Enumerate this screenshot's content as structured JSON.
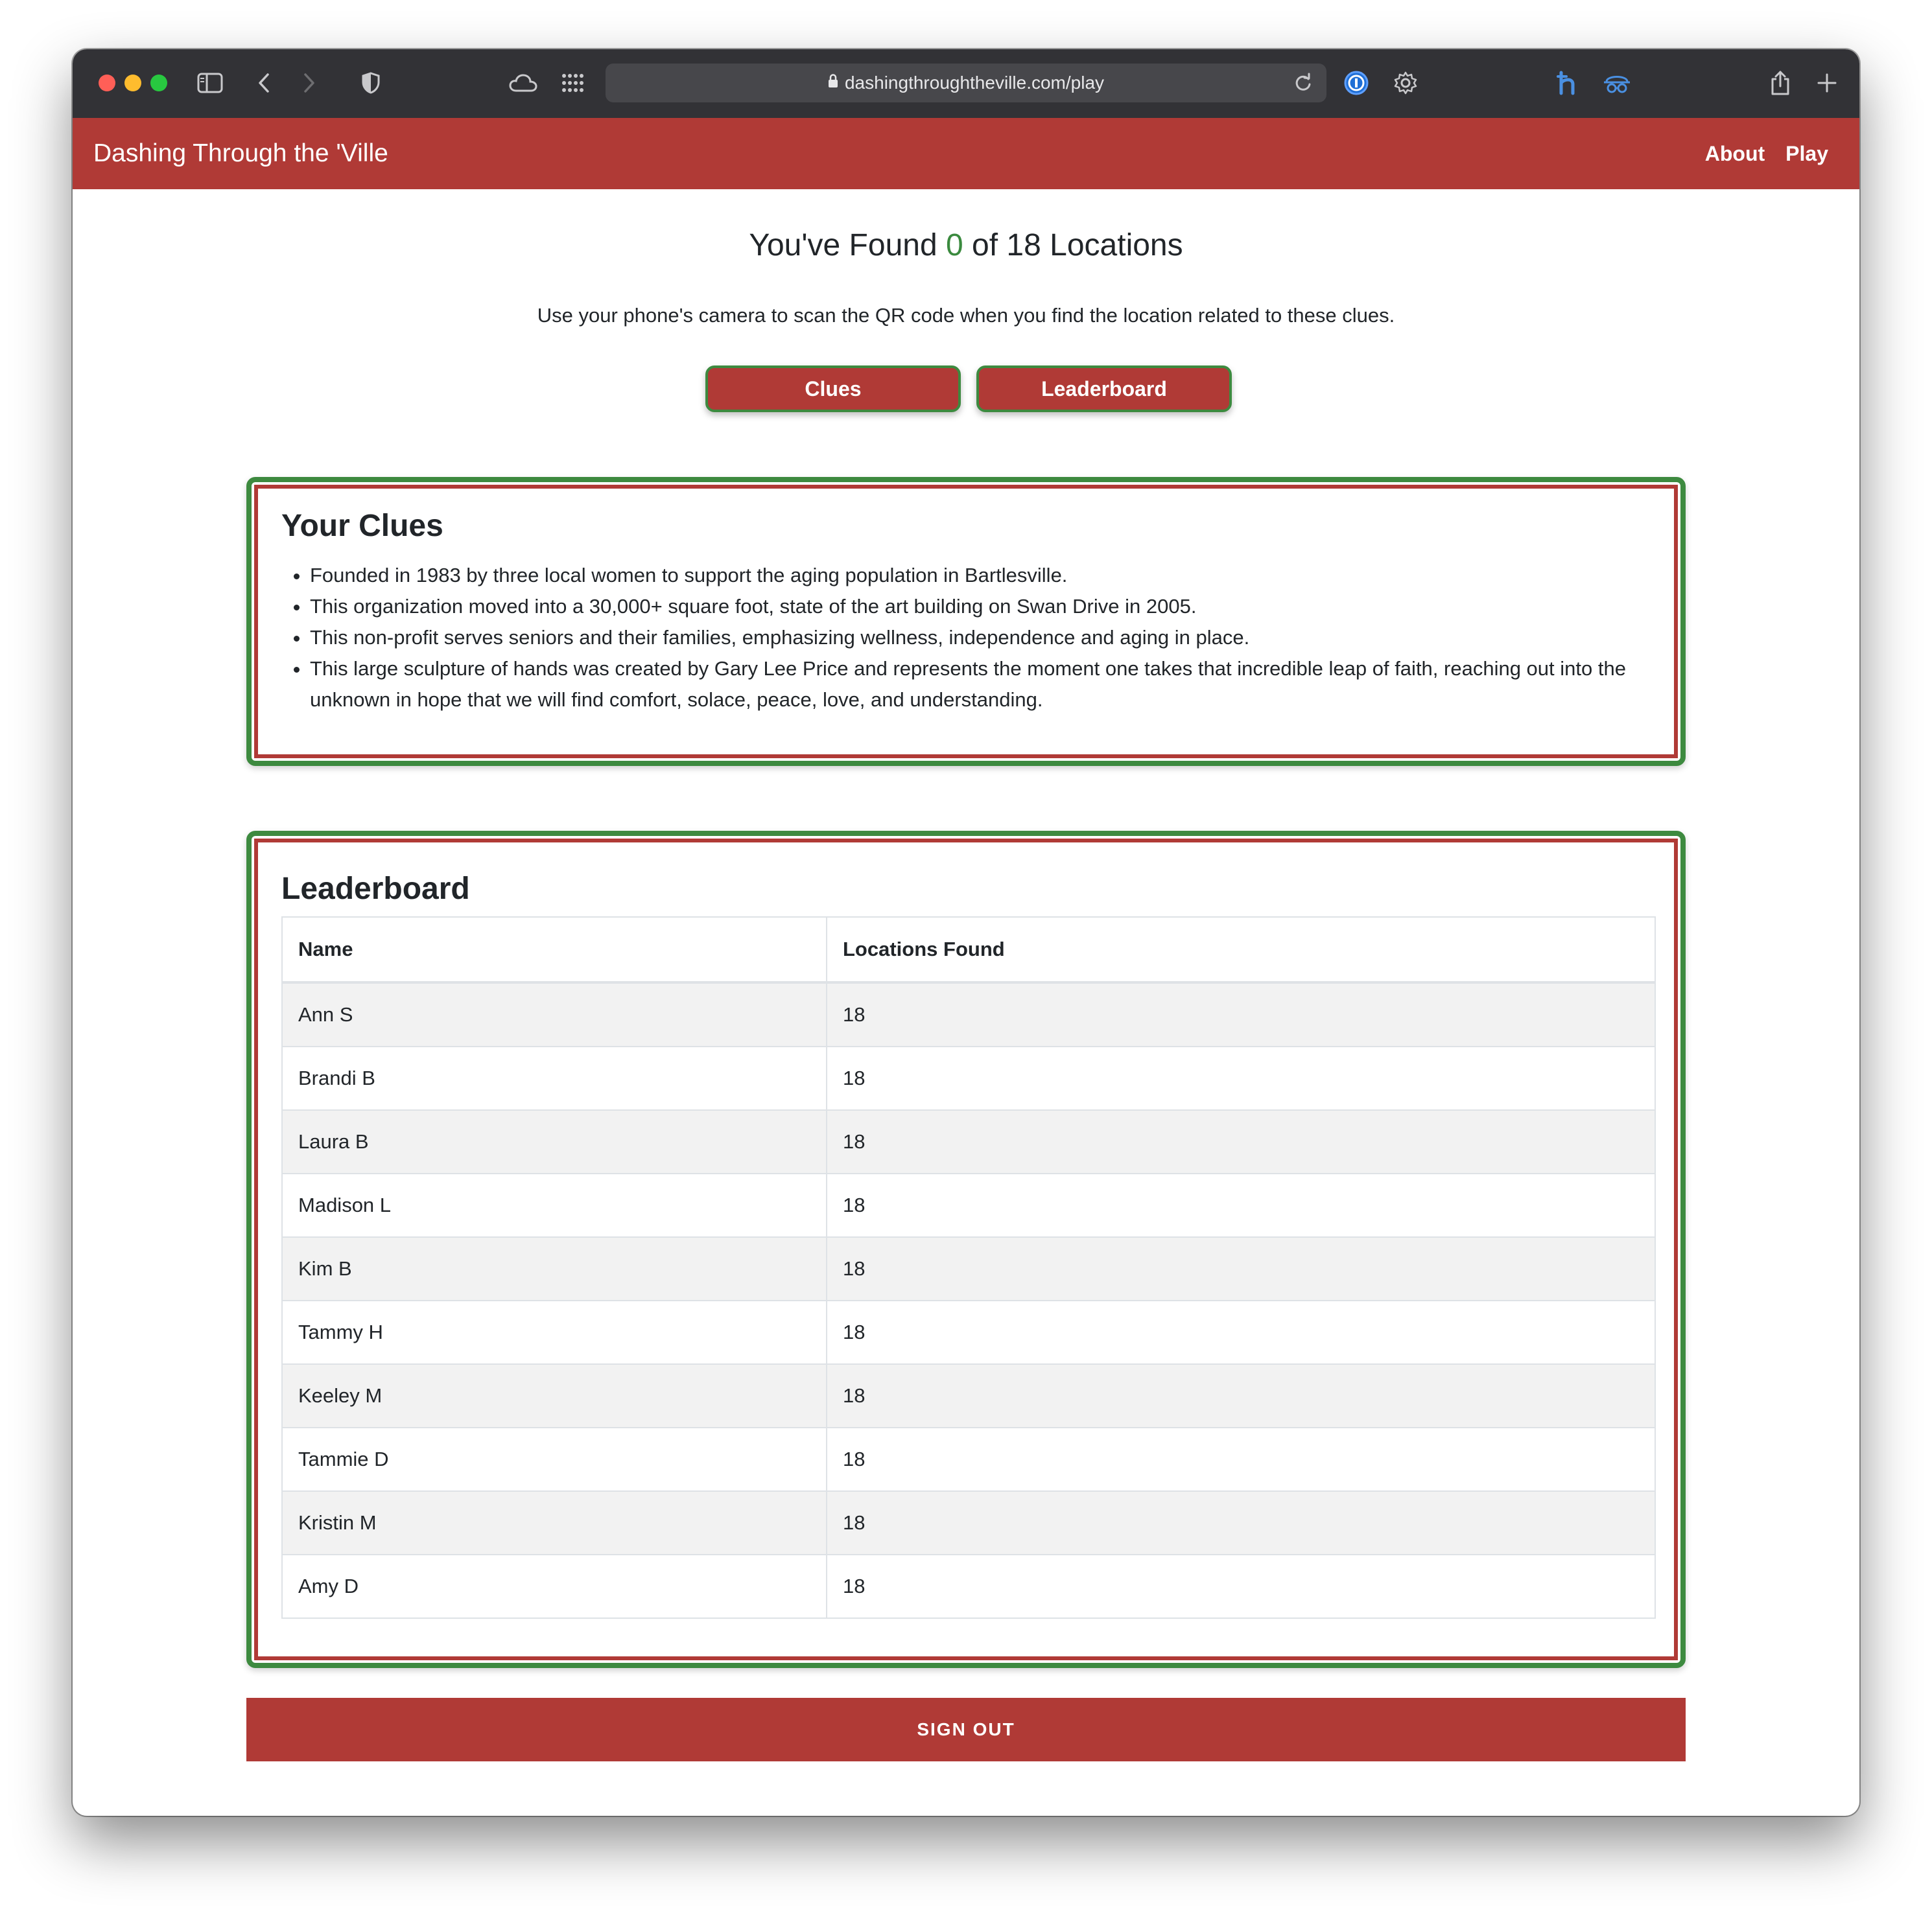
{
  "browser": {
    "url": "dashingthroughtheville.com/play"
  },
  "navbar": {
    "brand": "Dashing Through the 'Ville",
    "links": [
      "About",
      "Play"
    ]
  },
  "main": {
    "heading_prefix": "You've Found",
    "found_count": "0",
    "heading_suffix": "of 18 Locations",
    "instructions": "Use your phone's camera to scan the QR code when you find the location related to these clues.",
    "buttons": [
      "Clues",
      "Leaderboard"
    ]
  },
  "clues": {
    "title": "Your Clues",
    "items": [
      "Founded in 1983 by three local women to support the aging population in Bartlesville.",
      "This organization moved into a 30,000+ square foot, state of the art building on Swan Drive in 2005.",
      "This non-profit serves seniors and their families, emphasizing wellness, independence and aging in place.",
      "This large sculpture of hands was created by Gary Lee Price and represents the moment one takes that incredible leap of faith, reaching out into the unknown in hope that we will find comfort, solace, peace, love, and understanding."
    ]
  },
  "leaderboard": {
    "title": "Leaderboard",
    "columns": [
      "Name",
      "Locations Found"
    ],
    "rows": [
      [
        "Ann S",
        "18"
      ],
      [
        "Brandi B",
        "18"
      ],
      [
        "Laura B",
        "18"
      ],
      [
        "Madison L",
        "18"
      ],
      [
        "Kim B",
        "18"
      ],
      [
        "Tammy H",
        "18"
      ],
      [
        "Keeley M",
        "18"
      ],
      [
        "Tammie D",
        "18"
      ],
      [
        "Kristin M",
        "18"
      ],
      [
        "Amy D",
        "18"
      ]
    ]
  },
  "footer": {
    "sign_out": "SIGN OUT"
  },
  "colors": {
    "brand_red": "#b03a36",
    "accent_green": "#3d8a3f"
  },
  "icons": [
    "sidebar-icon",
    "back-icon",
    "forward-icon",
    "shield-icon",
    "cloud-icon",
    "grid-icon",
    "lock-icon",
    "reload-icon",
    "password-manager-icon",
    "gear-icon",
    "extension-h-icon",
    "extension-mask-icon",
    "share-icon",
    "new-tab-icon"
  ]
}
